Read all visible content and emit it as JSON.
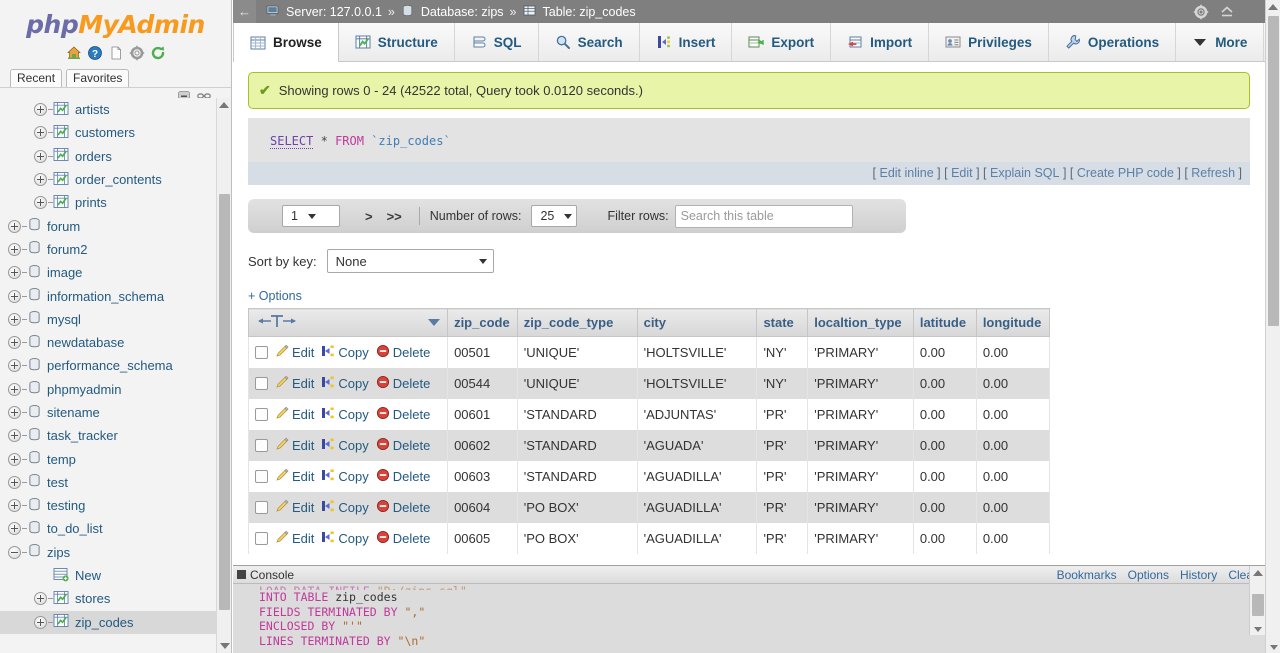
{
  "app": {
    "logo_php": "php",
    "logo_myadmin": "MyAdmin"
  },
  "sidebar": {
    "icons": [
      "home-icon",
      "help-icon",
      "docs-icon",
      "settings-icon",
      "reload-icon"
    ],
    "tabs": [
      {
        "label": "Recent",
        "name": "recent-tab"
      },
      {
        "label": "Favorites",
        "name": "favorites-tab"
      }
    ],
    "controls": [
      "collapse-icon",
      "link-icon"
    ],
    "tree": [
      {
        "label": "artists",
        "depth": 2,
        "kind": "table",
        "expander": "plus",
        "selected": false
      },
      {
        "label": "customers",
        "depth": 2,
        "kind": "table",
        "expander": "plus",
        "selected": false
      },
      {
        "label": "orders",
        "depth": 2,
        "kind": "table",
        "expander": "plus",
        "selected": false
      },
      {
        "label": "order_contents",
        "depth": 2,
        "kind": "table",
        "expander": "plus",
        "selected": false
      },
      {
        "label": "prints",
        "depth": 2,
        "kind": "table",
        "expander": "plus",
        "selected": false
      },
      {
        "label": "forum",
        "depth": 1,
        "kind": "database",
        "expander": "plus",
        "selected": false
      },
      {
        "label": "forum2",
        "depth": 1,
        "kind": "database",
        "expander": "plus",
        "selected": false
      },
      {
        "label": "image",
        "depth": 1,
        "kind": "database",
        "expander": "plus",
        "selected": false
      },
      {
        "label": "information_schema",
        "depth": 1,
        "kind": "database",
        "expander": "plus",
        "selected": false
      },
      {
        "label": "mysql",
        "depth": 1,
        "kind": "database",
        "expander": "plus",
        "selected": false
      },
      {
        "label": "newdatabase",
        "depth": 1,
        "kind": "database",
        "expander": "plus",
        "selected": false
      },
      {
        "label": "performance_schema",
        "depth": 1,
        "kind": "database",
        "expander": "plus",
        "selected": false
      },
      {
        "label": "phpmyadmin",
        "depth": 1,
        "kind": "database",
        "expander": "plus",
        "selected": false
      },
      {
        "label": "sitename",
        "depth": 1,
        "kind": "database",
        "expander": "plus",
        "selected": false
      },
      {
        "label": "task_tracker",
        "depth": 1,
        "kind": "database",
        "expander": "plus",
        "selected": false
      },
      {
        "label": "temp",
        "depth": 1,
        "kind": "database",
        "expander": "plus",
        "selected": false
      },
      {
        "label": "test",
        "depth": 1,
        "kind": "database",
        "expander": "plus",
        "selected": false
      },
      {
        "label": "testing",
        "depth": 1,
        "kind": "database",
        "expander": "plus",
        "selected": false
      },
      {
        "label": "to_do_list",
        "depth": 1,
        "kind": "database",
        "expander": "plus",
        "selected": false
      },
      {
        "label": "zips",
        "depth": 1,
        "kind": "database",
        "expander": "minus",
        "selected": false
      },
      {
        "label": "New",
        "depth": 2,
        "kind": "new",
        "expander": "none",
        "selected": false
      },
      {
        "label": "stores",
        "depth": 2,
        "kind": "table",
        "expander": "plus",
        "selected": false
      },
      {
        "label": "zip_codes",
        "depth": 2,
        "kind": "table",
        "expander": "plus",
        "selected": true
      }
    ]
  },
  "topbar": {
    "back_label": "←",
    "server_label": "Server: 127.0.0.1",
    "database_label": "Database: zips",
    "table_label": "Table: zip_codes",
    "separator": "»",
    "right_icons": [
      "settings-icon",
      "collapse-icon"
    ]
  },
  "tabs": [
    {
      "label": "Browse",
      "icon": "browse-icon",
      "active": true
    },
    {
      "label": "Structure",
      "icon": "structure-icon",
      "active": false
    },
    {
      "label": "SQL",
      "icon": "sql-icon",
      "active": false
    },
    {
      "label": "Search",
      "icon": "search-icon",
      "active": false
    },
    {
      "label": "Insert",
      "icon": "insert-icon",
      "active": false
    },
    {
      "label": "Export",
      "icon": "export-icon",
      "active": false
    },
    {
      "label": "Import",
      "icon": "import-icon",
      "active": false
    },
    {
      "label": "Privileges",
      "icon": "privileges-icon",
      "active": false
    },
    {
      "label": "Operations",
      "icon": "operations-icon",
      "active": false
    },
    {
      "label": "More",
      "icon": "chevron-down-icon",
      "active": false
    }
  ],
  "status": {
    "message": "Showing rows 0 - 24 (42522 total, Query took 0.0120 seconds.)",
    "icon": "check-icon"
  },
  "sql": {
    "keyword_select": "SELECT",
    "star": "*",
    "keyword_from": "FROM",
    "table": "`zip_codes`",
    "actions": [
      {
        "label": "Edit inline",
        "name": "edit-inline-link"
      },
      {
        "label": "Edit",
        "name": "edit-link"
      },
      {
        "label": "Explain SQL",
        "name": "explain-sql-link"
      },
      {
        "label": "Create PHP code",
        "name": "create-php-code-link"
      },
      {
        "label": "Refresh",
        "name": "refresh-link"
      }
    ]
  },
  "pagination": {
    "page_value": "1",
    "next_label": ">",
    "last_label": ">>",
    "rows_label": "Number of rows:",
    "rows_value": "25",
    "filter_label": "Filter rows:",
    "filter_placeholder": "Search this table",
    "filter_value": ""
  },
  "sort": {
    "label": "Sort by key:",
    "value": "None"
  },
  "options_link": "+ Options",
  "table": {
    "sort_header_icon": "sort-arrows-icon",
    "dropdown_icon": "chevron-down-icon",
    "row_actions": [
      {
        "label": "Edit",
        "icon": "pencil-icon",
        "name": "edit-row-link"
      },
      {
        "label": "Copy",
        "icon": "copy-icon",
        "name": "copy-row-link"
      },
      {
        "label": "Delete",
        "icon": "delete-icon",
        "name": "delete-row-link"
      }
    ],
    "columns": [
      "zip_code",
      "zip_code_type",
      "city",
      "state",
      "localtion_type",
      "latitude",
      "longitude"
    ],
    "rows": [
      {
        "zip_code": "00501",
        "zip_code_type": "'UNIQUE'",
        "city": "'HOLTSVILLE'",
        "state": "'NY'",
        "localtion_type": "'PRIMARY'",
        "latitude": "0.00",
        "longitude": "0.00"
      },
      {
        "zip_code": "00544",
        "zip_code_type": "'UNIQUE'",
        "city": "'HOLTSVILLE'",
        "state": "'NY'",
        "localtion_type": "'PRIMARY'",
        "latitude": "0.00",
        "longitude": "0.00"
      },
      {
        "zip_code": "00601",
        "zip_code_type": "'STANDARD",
        "city": "'ADJUNTAS'",
        "state": "'PR'",
        "localtion_type": "'PRIMARY'",
        "latitude": "0.00",
        "longitude": "0.00"
      },
      {
        "zip_code": "00602",
        "zip_code_type": "'STANDARD",
        "city": "'AGUADA'",
        "state": "'PR'",
        "localtion_type": "'PRIMARY'",
        "latitude": "0.00",
        "longitude": "0.00"
      },
      {
        "zip_code": "00603",
        "zip_code_type": "'STANDARD",
        "city": "'AGUADILLA'",
        "state": "'PR'",
        "localtion_type": "'PRIMARY'",
        "latitude": "0.00",
        "longitude": "0.00"
      },
      {
        "zip_code": "00604",
        "zip_code_type": "'PO BOX'",
        "city": "'AGUADILLA'",
        "state": "'PR'",
        "localtion_type": "'PRIMARY'",
        "latitude": "0.00",
        "longitude": "0.00"
      },
      {
        "zip_code": "00605",
        "zip_code_type": "'PO BOX'",
        "city": "'AGUADILLA'",
        "state": "'PR'",
        "localtion_type": "'PRIMARY'",
        "latitude": "0.00",
        "longitude": "0.00"
      }
    ]
  },
  "console": {
    "title": "Console",
    "actions": [
      {
        "label": "Bookmarks",
        "name": "console-bookmarks"
      },
      {
        "label": "Options",
        "name": "console-options"
      },
      {
        "label": "History",
        "name": "console-history"
      },
      {
        "label": "Clear",
        "name": "console-clear"
      }
    ],
    "lines": [
      "LOAD DATA INFILE \"D:/zips.sql\"",
      "INTO TABLE zip_codes",
      "FIELDS TERMINATED BY \",\"",
      "ENCLOSED BY \"'\"",
      "LINES TERMINATED BY \"\\n\""
    ]
  },
  "colors": {
    "accent_orange": "#f79a1e",
    "accent_purple": "#6c6ca8",
    "topbar_gray": "#7f7f7f",
    "success_bg": "#e8f5a9",
    "success_border": "#a5c12a",
    "link_blue": "#235a81",
    "row_alt": "#dddddd"
  }
}
